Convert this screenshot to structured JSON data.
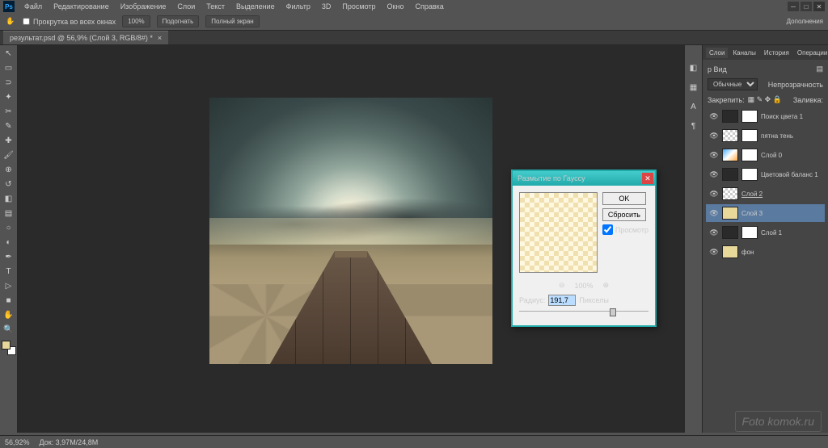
{
  "app": {
    "logo": "Ps"
  },
  "menu": [
    "Файл",
    "Редактирование",
    "Изображение",
    "Слои",
    "Текст",
    "Выделение",
    "Фильтр",
    "3D",
    "Просмотр",
    "Окно",
    "Справка"
  ],
  "options": {
    "scroll_all": "Прокрутка во всех окнах",
    "zoom_actual": "100%",
    "fit_screen": "Подогнать",
    "full_screen": "Полный экран"
  },
  "doc_tab": {
    "title": "результат.psd @ 56,9% (Слой 3, RGB/8#) *"
  },
  "status": {
    "zoom": "56,92%",
    "doc_info": "Док: 3,97M/24,8M"
  },
  "workspace_label": "Дополнения",
  "dialog": {
    "title": "Размытие по Гауссу",
    "ok": "OK",
    "reset": "Сбросить",
    "preview": "Просмотр",
    "zoom_level": "100%",
    "radius_label": "Радиус:",
    "radius_value": "191,7",
    "radius_unit": "Пикселы"
  },
  "panels": {
    "tabs": [
      "Слои",
      "Каналы",
      "История",
      "Операции"
    ],
    "kind_label": "р Вид",
    "blend_mode": "Обычные",
    "opacity_label": "Непрозрачность",
    "lock_label": "Закрепить:",
    "fill_label": "Заливка:",
    "layers": [
      {
        "name": "Поиск цвета 1"
      },
      {
        "name": "пятна тень"
      },
      {
        "name": "Слой 0"
      },
      {
        "name": "Цветовой баланс 1"
      },
      {
        "name": "Слой 2"
      },
      {
        "name": "Слой 3"
      },
      {
        "name": "Слой 1"
      },
      {
        "name": "фон"
      }
    ]
  },
  "watermark": "Foto komok.ru"
}
